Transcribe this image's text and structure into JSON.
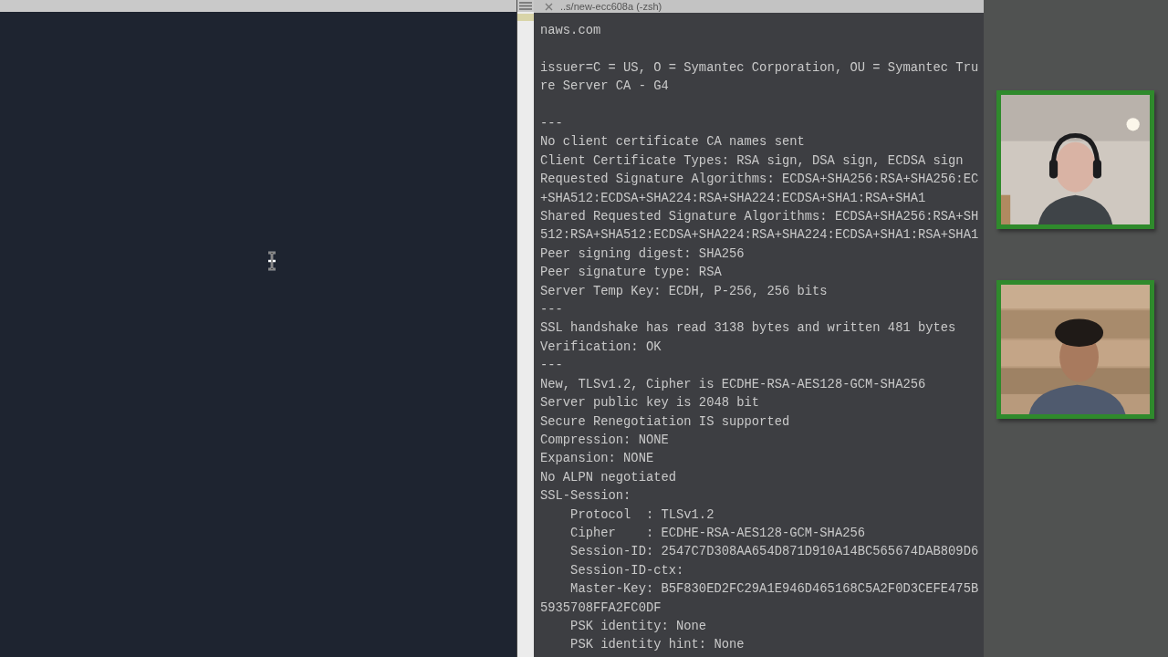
{
  "terminal": {
    "title": "..s/new-ecc608a (-zsh)",
    "lines": [
      {
        "kind": "text",
        "text": "naws.com"
      },
      {
        "kind": "blank"
      },
      {
        "kind": "text",
        "text": "issuer=C = US, O = Symantec Corporation, OU = Symantec Tru"
      },
      {
        "kind": "text",
        "text": "re Server CA - G4"
      },
      {
        "kind": "blank"
      },
      {
        "kind": "text",
        "text": "---"
      },
      {
        "kind": "text",
        "text": "No client certificate CA names sent"
      },
      {
        "kind": "text",
        "text": "Client Certificate Types: RSA sign, DSA sign, ECDSA sign"
      },
      {
        "kind": "text",
        "text": "Requested Signature Algorithms: ECDSA+SHA256:RSA+SHA256:EC"
      },
      {
        "kind": "text",
        "text": "+SHA512:ECDSA+SHA224:RSA+SHA224:ECDSA+SHA1:RSA+SHA1"
      },
      {
        "kind": "text",
        "text": "Shared Requested Signature Algorithms: ECDSA+SHA256:RSA+SH"
      },
      {
        "kind": "text",
        "text": "512:RSA+SHA512:ECDSA+SHA224:RSA+SHA224:ECDSA+SHA1:RSA+SHA1"
      },
      {
        "kind": "text",
        "text": "Peer signing digest: SHA256"
      },
      {
        "kind": "text",
        "text": "Peer signature type: RSA"
      },
      {
        "kind": "text",
        "text": "Server Temp Key: ECDH, P-256, 256 bits"
      },
      {
        "kind": "text",
        "text": "---"
      },
      {
        "kind": "text",
        "text": "SSL handshake has read 3138 bytes and written 481 bytes"
      },
      {
        "kind": "text",
        "text": "Verification: OK"
      },
      {
        "kind": "text",
        "text": "---"
      },
      {
        "kind": "text",
        "text": "New, TLSv1.2, Cipher is ECDHE-RSA-AES128-GCM-SHA256"
      },
      {
        "kind": "text",
        "text": "Server public key is 2048 bit"
      },
      {
        "kind": "text",
        "text": "Secure Renegotiation IS supported"
      },
      {
        "kind": "text",
        "text": "Compression: NONE"
      },
      {
        "kind": "text",
        "text": "Expansion: NONE"
      },
      {
        "kind": "text",
        "text": "No ALPN negotiated"
      },
      {
        "kind": "text",
        "text": "SSL-Session:"
      },
      {
        "kind": "text",
        "text": "    Protocol  : TLSv1.2"
      },
      {
        "kind": "text",
        "text": "    Cipher    : ECDHE-RSA-AES128-GCM-SHA256"
      },
      {
        "kind": "text",
        "text": "    Session-ID: 2547C7D308AA654D871D910A14BC565674DAB809D6"
      },
      {
        "kind": "text",
        "text": "    Session-ID-ctx:"
      },
      {
        "kind": "text",
        "text": "    Master-Key: B5F830ED2FC29A1E946D465168C5A2F0D3CEFE475B"
      },
      {
        "kind": "text",
        "text": "5935708FFA2FC0DF"
      },
      {
        "kind": "text",
        "text": "    PSK identity: None"
      },
      {
        "kind": "text",
        "text": "    PSK identity hint: None"
      }
    ]
  },
  "participants": [
    {
      "kind": "picture",
      "speaking": true
    },
    {
      "kind": "picture",
      "speaking": true
    }
  ]
}
